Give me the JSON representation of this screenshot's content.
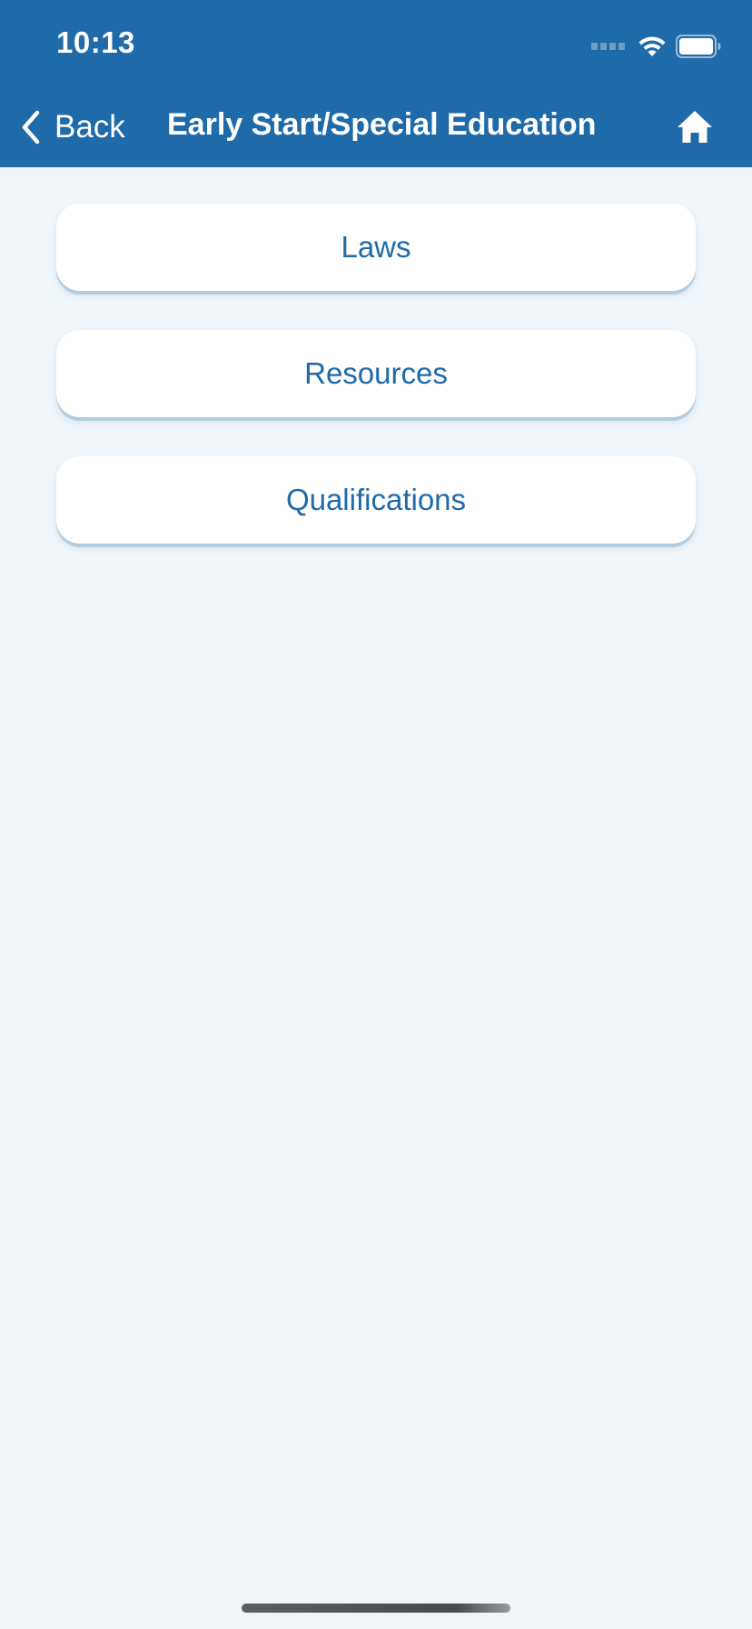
{
  "status_bar": {
    "time": "10:13"
  },
  "nav": {
    "back_label": "Back",
    "title": "Early Start/Special Education",
    "home_icon": "home-icon"
  },
  "menu": {
    "items": [
      {
        "label": "Laws"
      },
      {
        "label": "Resources"
      },
      {
        "label": "Qualifications"
      }
    ]
  },
  "colors": {
    "header_bg": "#1f6aa9",
    "page_bg": "#eff5f9",
    "button_text": "#1f6aa9",
    "button_bg": "#ffffff"
  }
}
